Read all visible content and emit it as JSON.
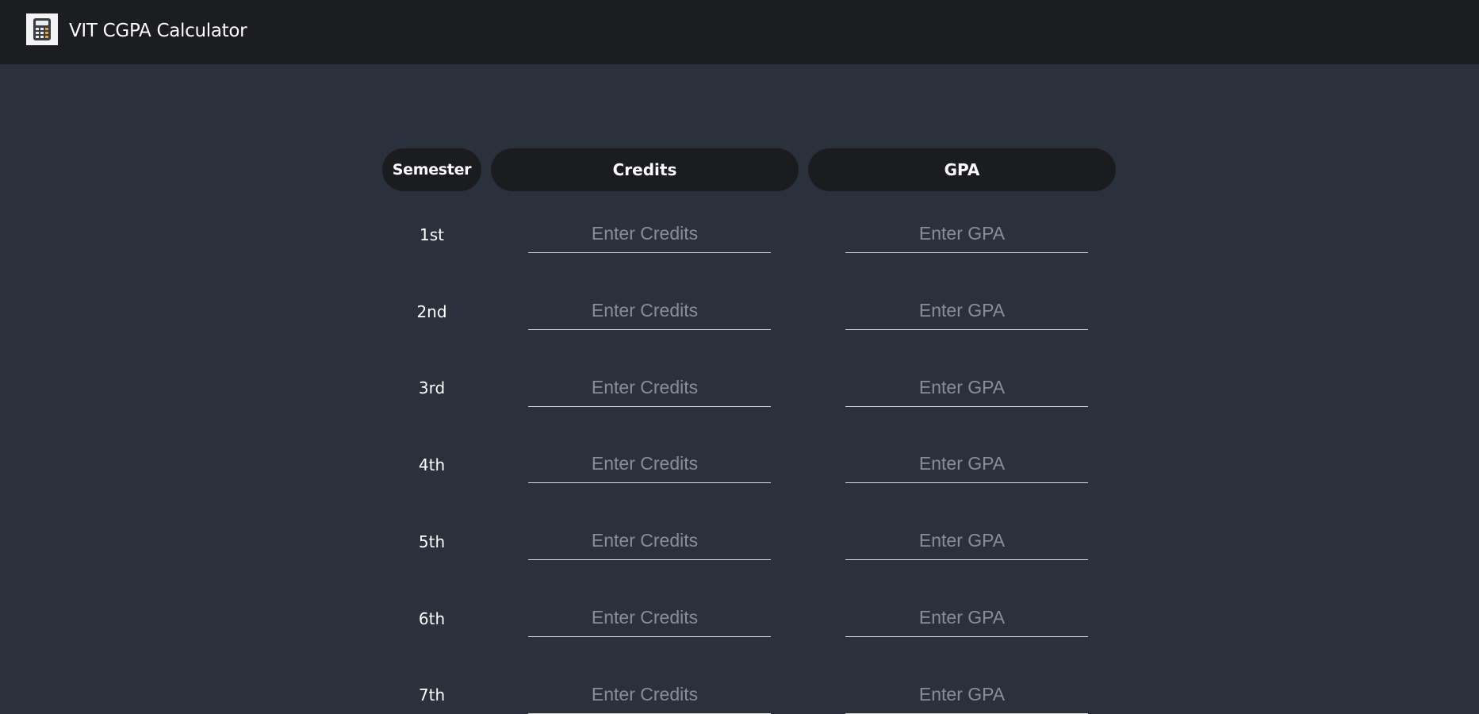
{
  "app": {
    "title": "VIT CGPA Calculator",
    "logo_icon": "calculator-icon"
  },
  "table": {
    "headers": {
      "semester": "Semester",
      "credits": "Credits",
      "gpa": "GPA"
    },
    "credits_placeholder": "Enter Credits",
    "gpa_placeholder": "Enter GPA",
    "rows": [
      {
        "semester": "1st",
        "credits": "",
        "gpa": ""
      },
      {
        "semester": "2nd",
        "credits": "",
        "gpa": ""
      },
      {
        "semester": "3rd",
        "credits": "",
        "gpa": ""
      },
      {
        "semester": "4th",
        "credits": "",
        "gpa": ""
      },
      {
        "semester": "5th",
        "credits": "",
        "gpa": ""
      },
      {
        "semester": "6th",
        "credits": "",
        "gpa": ""
      },
      {
        "semester": "7th",
        "credits": "",
        "gpa": ""
      }
    ]
  },
  "colors": {
    "background": "#2b313c",
    "navbar": "#1c1d20",
    "pill": "#1b1c1f",
    "text": "#ffffff",
    "placeholder": "#8a8e94"
  }
}
